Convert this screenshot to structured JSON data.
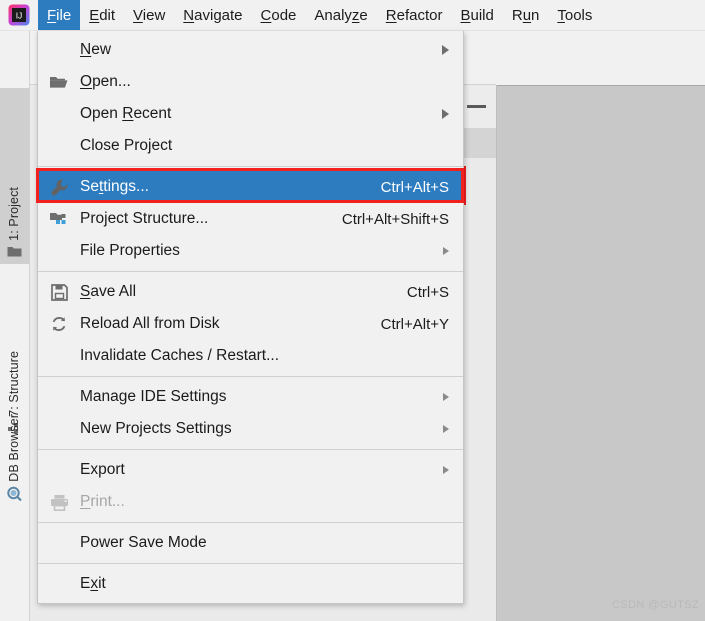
{
  "app": {
    "logo_icon": "intellij-idea-logo",
    "watermark": "CSDN @GUTSZ"
  },
  "menubar": {
    "items": [
      {
        "label": "File",
        "mnemonic": "F",
        "active": true
      },
      {
        "label": "Edit",
        "mnemonic": "E",
        "active": false
      },
      {
        "label": "View",
        "mnemonic": "V",
        "active": false
      },
      {
        "label": "Navigate",
        "mnemonic": "N",
        "active": false
      },
      {
        "label": "Code",
        "mnemonic": "C",
        "active": false
      },
      {
        "label": "Analyze",
        "mnemonic": "z",
        "active": false
      },
      {
        "label": "Refactor",
        "mnemonic": "R",
        "active": false
      },
      {
        "label": "Build",
        "mnemonic": "B",
        "active": false
      },
      {
        "label": "Run",
        "mnemonic": "u",
        "active": false
      },
      {
        "label": "Tools",
        "mnemonic": "T",
        "active": false
      }
    ]
  },
  "sidebar": {
    "tabs": [
      {
        "label": "1: Project",
        "icon": "folder-icon",
        "selected": true
      },
      {
        "label": "7: Structure",
        "icon": "structure-icon",
        "selected": false
      },
      {
        "label": "DB Browser",
        "icon": "db-browser-icon",
        "selected": false
      }
    ]
  },
  "file_menu": {
    "items": [
      {
        "id": "new",
        "label": "New",
        "icon": null,
        "accel": "",
        "submenu": true,
        "highlight": false,
        "disabled": false
      },
      {
        "id": "open",
        "label": "Open...",
        "icon": "open-folder-icon",
        "accel": "",
        "submenu": false,
        "highlight": false,
        "disabled": false
      },
      {
        "id": "open-recent",
        "label": "Open Recent",
        "icon": null,
        "accel": "",
        "submenu": true,
        "highlight": false,
        "disabled": false
      },
      {
        "id": "close-project",
        "label": "Close Project",
        "icon": null,
        "accel": "",
        "submenu": false,
        "highlight": false,
        "disabled": false
      },
      {
        "id": "sep1",
        "separator": true
      },
      {
        "id": "settings",
        "label": "Settings...",
        "icon": "wrench-icon",
        "accel": "Ctrl+Alt+S",
        "submenu": false,
        "highlight": true,
        "disabled": false
      },
      {
        "id": "project-structure",
        "label": "Project Structure...",
        "icon": "project-structure-icon",
        "accel": "Ctrl+Alt+Shift+S",
        "submenu": false,
        "highlight": false,
        "disabled": false
      },
      {
        "id": "file-properties",
        "label": "File Properties",
        "icon": null,
        "accel": "",
        "submenu": true,
        "highlight": false,
        "disabled": false
      },
      {
        "id": "sep2",
        "separator": true
      },
      {
        "id": "save-all",
        "label": "Save All",
        "icon": "floppy-disk-icon",
        "accel": "Ctrl+S",
        "submenu": false,
        "highlight": false,
        "disabled": false
      },
      {
        "id": "reload-all",
        "label": "Reload All from Disk",
        "icon": "refresh-icon",
        "accel": "Ctrl+Alt+Y",
        "submenu": false,
        "highlight": false,
        "disabled": false
      },
      {
        "id": "invalidate-caches",
        "label": "Invalidate Caches / Restart...",
        "icon": null,
        "accel": "",
        "submenu": false,
        "highlight": false,
        "disabled": false
      },
      {
        "id": "sep3",
        "separator": true
      },
      {
        "id": "manage-ide-settings",
        "label": "Manage IDE Settings",
        "icon": null,
        "accel": "",
        "submenu": true,
        "highlight": false,
        "disabled": false
      },
      {
        "id": "new-projects-settings",
        "label": "New Projects Settings",
        "icon": null,
        "accel": "",
        "submenu": true,
        "highlight": false,
        "disabled": false
      },
      {
        "id": "sep4",
        "separator": true
      },
      {
        "id": "export",
        "label": "Export",
        "icon": null,
        "accel": "",
        "submenu": true,
        "highlight": false,
        "disabled": false
      },
      {
        "id": "print",
        "label": "Print...",
        "icon": "printer-icon",
        "accel": "",
        "submenu": false,
        "highlight": false,
        "disabled": true
      },
      {
        "id": "sep5",
        "separator": true
      },
      {
        "id": "power-save-mode",
        "label": "Power Save Mode",
        "icon": null,
        "accel": "",
        "submenu": false,
        "highlight": false,
        "disabled": false
      },
      {
        "id": "sep6",
        "separator": true
      },
      {
        "id": "exit",
        "label": "Exit",
        "icon": null,
        "accel": "",
        "submenu": false,
        "highlight": false,
        "disabled": false
      }
    ]
  },
  "annotation": {
    "highlight_color": "#f32020",
    "target": "Settings..."
  },
  "colors": {
    "menu_bg": "#f1f1f1",
    "highlight_blue": "#2d7cc0",
    "editor_gray": "#c8c8c8",
    "accent_red": "#f32020"
  }
}
